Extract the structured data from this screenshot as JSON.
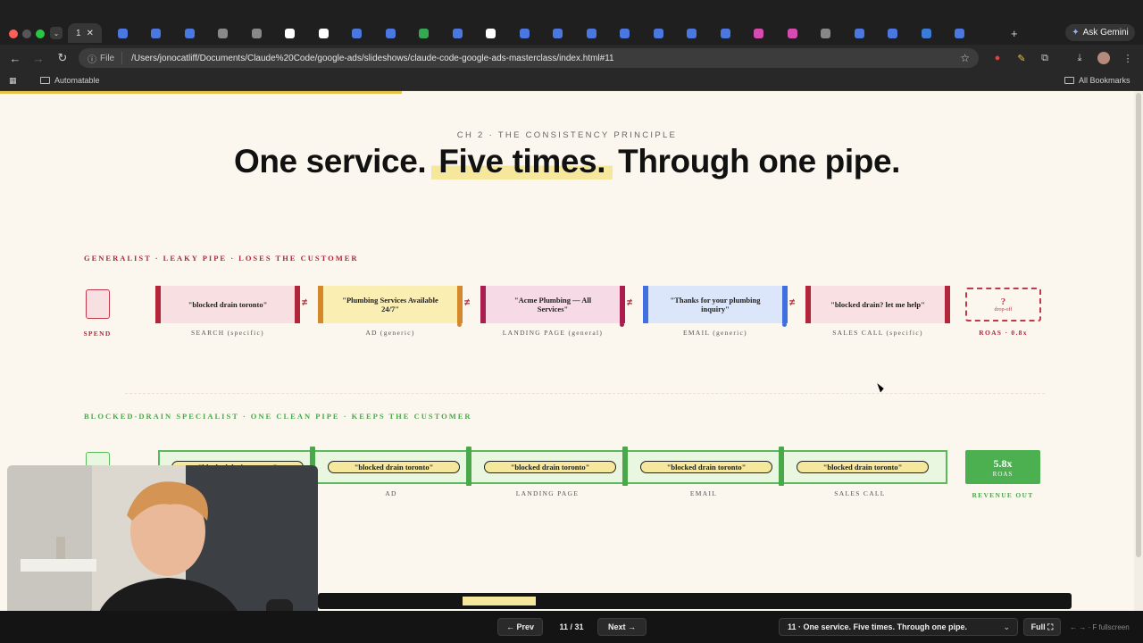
{
  "browser": {
    "active_tab_title": "1",
    "ask_gemini": "Ask Gemini",
    "omnibox": {
      "scheme_chip": "File",
      "url": "/Users/jonocatliff/Documents/Claude%20Code/google-ads/slideshows/claude-code-google-ads-masterclass/index.html#11"
    },
    "bookmarks": {
      "folder": "Automatable",
      "all_bookmarks": "All Bookmarks"
    },
    "icons": [
      "back-icon",
      "forward-icon",
      "reload-icon",
      "info-icon",
      "star-icon",
      "extensions-icon",
      "download-icon",
      "menu-icon",
      "apps-icon",
      "folder-icon"
    ]
  },
  "slide": {
    "eyebrow": "CH 2 · THE CONSISTENCY PRINCIPLE",
    "headline": {
      "part1": "One service.",
      "highlight": "Five times.",
      "part2": "Through one pipe."
    },
    "generalist": {
      "label": "GENERALIST · LEAKY PIPE · LOSES THE CUSTOMER",
      "spend_label": "SPEND",
      "stages": [
        {
          "text": "\"blocked drain toronto\"",
          "label": "SEARCH (specific)",
          "fill": "#f8dfe2",
          "border": "#b3263a"
        },
        {
          "text": "\"Plumbing Services Available 24/7\"",
          "label": "AD (generic)",
          "fill": "#fbeeb3",
          "border": "#d5882a"
        },
        {
          "text": "\"Acme Plumbing — All Services\"",
          "label": "LANDING PAGE (general)",
          "fill": "#f6dbe6",
          "border": "#a91e4f"
        },
        {
          "text": "\"Thanks for your plumbing inquiry\"",
          "label": "EMAIL (generic)",
          "fill": "#dbe6fb",
          "border": "#3f6fe0"
        },
        {
          "text": "\"blocked drain? let me help\"",
          "label": "SALES CALL (specific)",
          "fill": "#f9e0e3",
          "border": "#b3263a"
        }
      ],
      "neq_symbol": "≠",
      "outcome": {
        "value": "?",
        "sub": "drop-off",
        "label": "ROAS · 0.8x"
      }
    },
    "specialist": {
      "label": "BLOCKED-DRAIN SPECIALIST · ONE CLEAN PIPE · KEEPS THE CUSTOMER",
      "pill_text": "\"blocked drain toronto\"",
      "stage_labels": [
        "AD",
        "LANDING PAGE",
        "EMAIL",
        "SALES CALL"
      ],
      "outcome": {
        "value": "5.8x",
        "sub": "ROAS",
        "label": "REVENUE OUT"
      }
    },
    "accent_colors": {
      "highlight": "#f5e79c",
      "bad": "#c0394a",
      "good": "#4caf50"
    }
  },
  "footer": {
    "prev": "← Prev",
    "page": "11 / 31",
    "next": "Next →",
    "slide_select": "11 · One service. Five times. Through one pipe.",
    "full": "Full ⛶",
    "hint": "← → · F fullscreen"
  }
}
